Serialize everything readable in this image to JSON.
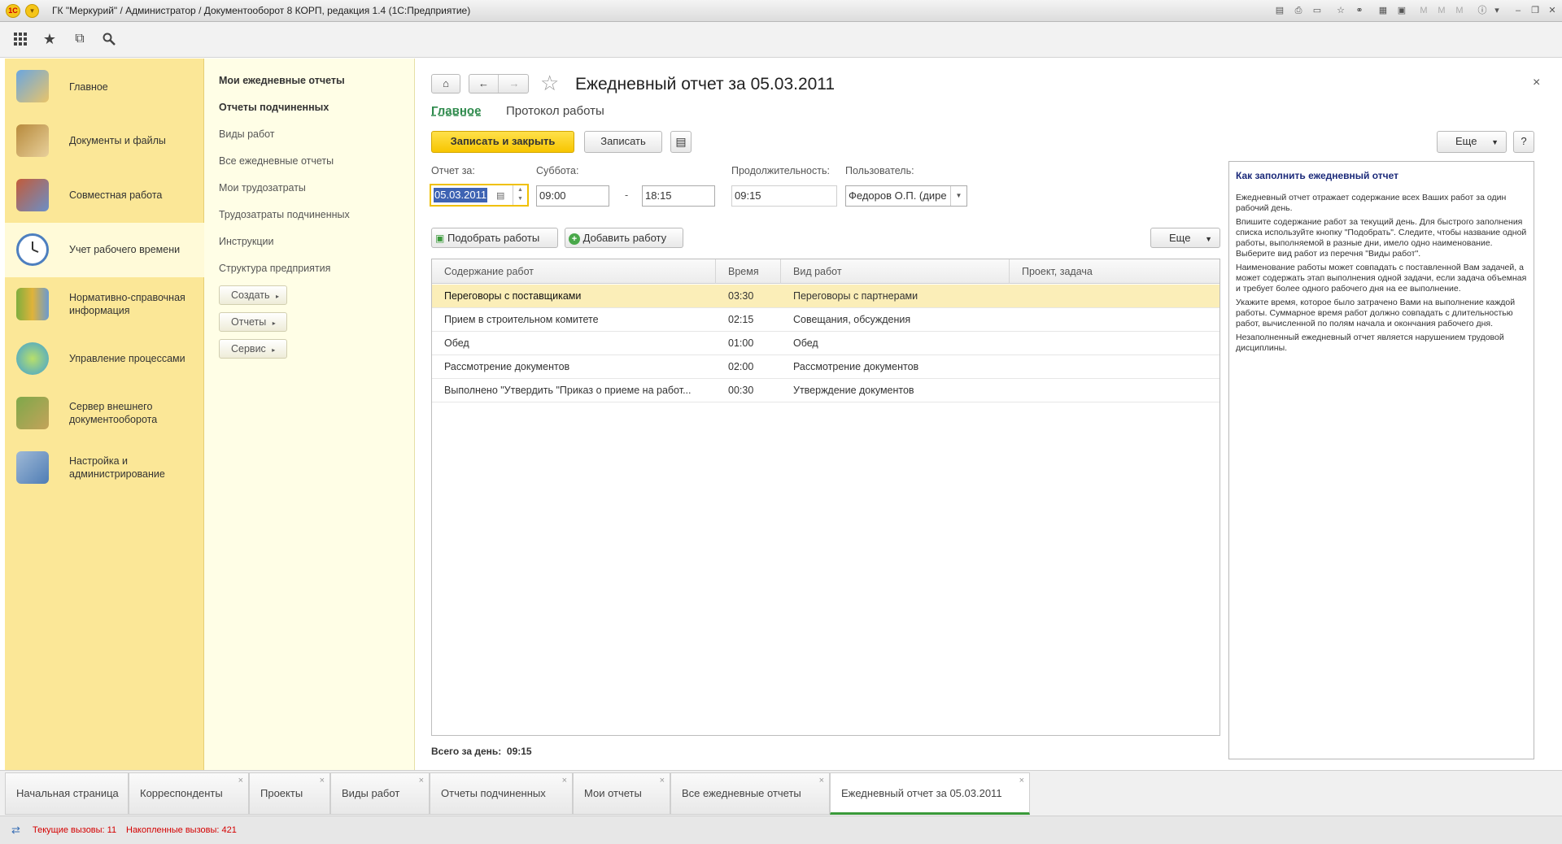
{
  "window": {
    "title": "ГК \"Меркурий\" / Администратор / Документооборот 8 КОРП, редакция 1.4  (1С:Предприятие)"
  },
  "sections": [
    {
      "label": "Главное"
    },
    {
      "label": "Документы и файлы"
    },
    {
      "label": "Совместная работа"
    },
    {
      "label": "Учет рабочего времени"
    },
    {
      "label": "Нормативно-справочная информация"
    },
    {
      "label": "Управление процессами"
    },
    {
      "label": "Сервер внешнего документооборота"
    },
    {
      "label": "Настройка и администрирование"
    }
  ],
  "nav": {
    "items": [
      {
        "label": "Мои ежедневные отчеты"
      },
      {
        "label": "Отчеты подчиненных"
      },
      {
        "label": "Виды работ"
      },
      {
        "label": "Все ежедневные отчеты"
      },
      {
        "label": "Мои трудозатраты"
      },
      {
        "label": "Трудозатраты подчиненных"
      },
      {
        "label": "Инструкции"
      },
      {
        "label": "Структура предприятия"
      }
    ],
    "buttons": [
      {
        "label": "Создать"
      },
      {
        "label": "Отчеты"
      },
      {
        "label": "Сервис"
      }
    ]
  },
  "form": {
    "title": "Ежедневный отчет за 05.03.2011",
    "tabs": [
      "Главное",
      "Протокол работы"
    ],
    "save_close": "Записать и закрыть",
    "save": "Записать",
    "more": "Еще",
    "help": "?",
    "close": "×",
    "fields": {
      "report_date_label": "Отчет за:",
      "report_date": "05.03.2011",
      "day_label": "Суббота:",
      "start_time": "09:00",
      "dash": "-",
      "end_time": "18:15",
      "duration_label": "Продолжительность:",
      "duration": "09:15",
      "user_label": "Пользователь:",
      "user": "Федоров О.П. (дире"
    },
    "pick_works": "Подобрать работы",
    "add_work": "Добавить работу",
    "table_more": "Еще",
    "table": {
      "columns": [
        "Содержание работ",
        "Время",
        "Вид работ",
        "Проект, задача"
      ],
      "rows": [
        [
          "Переговоры с поставщиками",
          "03:30",
          "Переговоры с партнерами",
          ""
        ],
        [
          "Прием в строительном комитете",
          "02:15",
          "Совещания, обсуждения",
          ""
        ],
        [
          "Обед",
          "01:00",
          "Обед",
          ""
        ],
        [
          "Рассмотрение документов",
          "02:00",
          "Рассмотрение документов",
          ""
        ],
        [
          "Выполнено \"Утвердить \"Приказ о приеме на работ...",
          "00:30",
          "Утверждение документов",
          ""
        ]
      ]
    },
    "total": "Всего за день:  09:15"
  },
  "help": {
    "title": "Как заполнить ежедневный отчет",
    "paragraphs": [
      "Ежедневный отчет отражает содержание всех Ваших работ за один рабочий день.",
      "Впишите содержание работ за текущий день. Для быстрого заполнения списка используйте кнопку \"Подобрать\". Следите, чтобы название одной работы, выполняемой в разные дни, имело одно наименование. Выберите вид работ из перечня \"Виды работ\".",
      "Наименование работы может совпадать с поставленной Вам задачей, а может содержать этап выполнения одной задачи, если задача объемная и требует более одного рабочего дня на ее выполнение.",
      "Укажите время, которое было затрачено Вами на выполнение каждой работы. Суммарное время работ должно совпадать с длительностью работ, вычисленной по полям начала и окончания рабочего дня.",
      "Незаполненный ежедневный отчет является нарушением трудовой дисциплины."
    ]
  },
  "bottom_tabs": [
    "Начальная страница",
    "Корреспонденты",
    "Проекты",
    "Виды работ",
    "Отчеты подчиненных",
    "Мои отчеты",
    "Все ежедневные отчеты",
    "Ежедневный отчет за 05.03.2011"
  ],
  "status": {
    "current_calls": "Текущие вызовы: 11",
    "accumulated_calls": "Накопленные вызовы: 421"
  },
  "colors": {
    "sections_bg": "#fbe797",
    "nav_bg": "#fffee6",
    "primary_button": "#f7c500",
    "selected_row": "#fbeeb8",
    "active_tab_underline": "#3a9a3a",
    "status_text": "#d40000"
  }
}
